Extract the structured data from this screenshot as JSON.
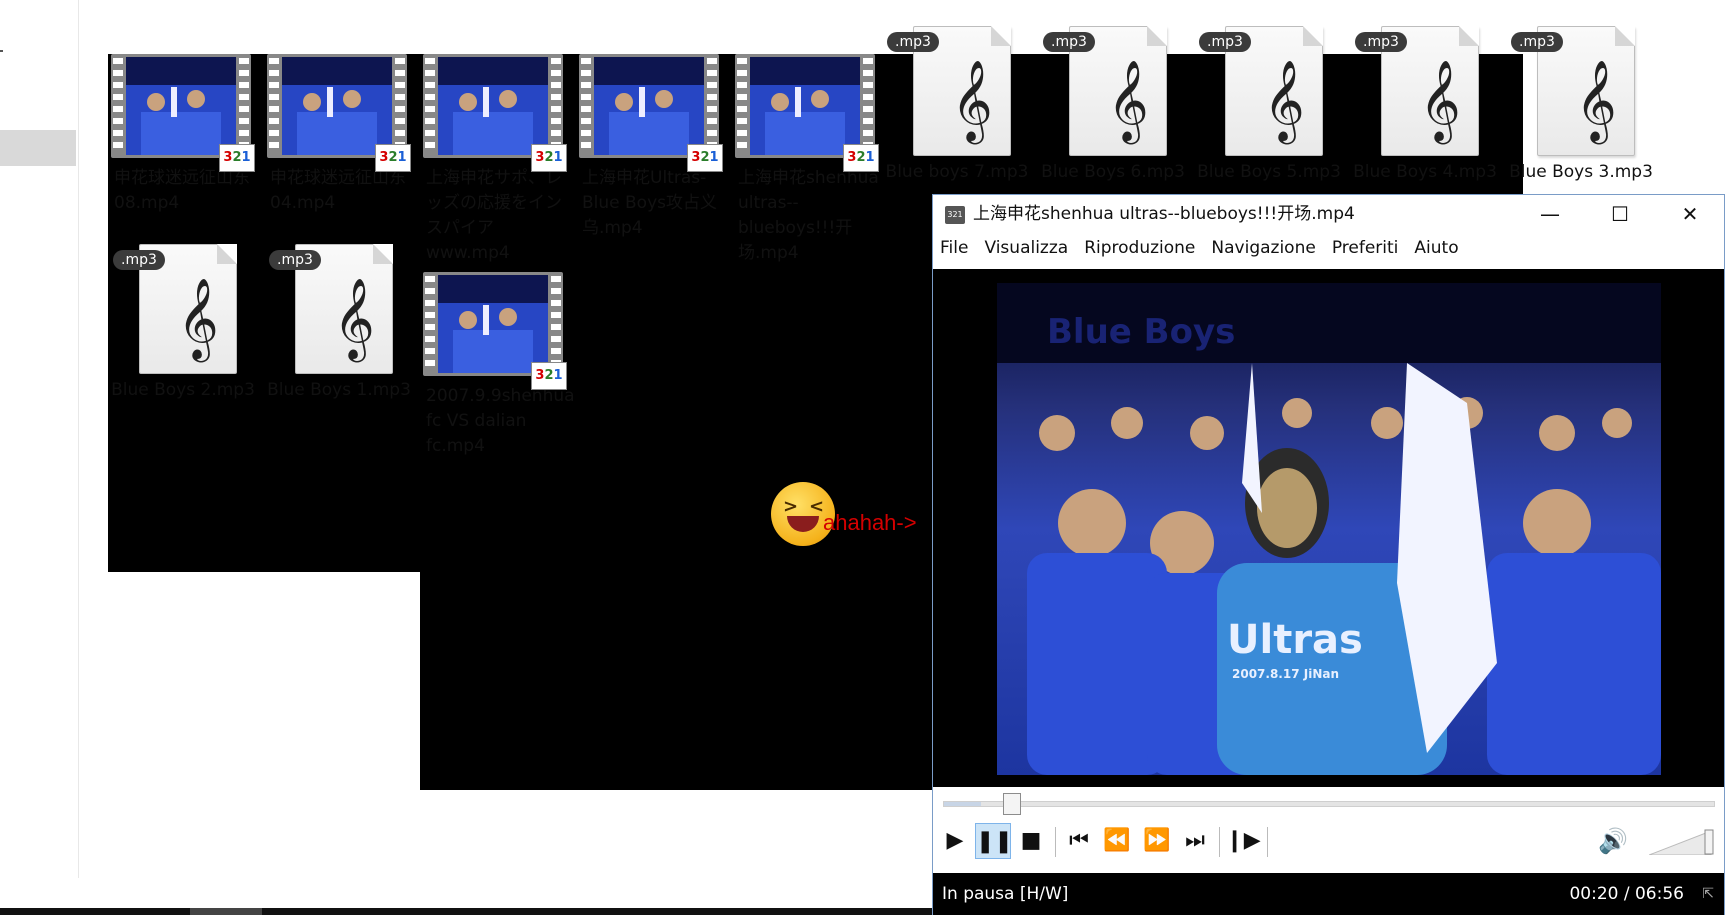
{
  "explorer": {
    "files": [
      {
        "name": "申花球迷远征山东08.mp4",
        "type": "video"
      },
      {
        "name": "申花球迷远征山东04.mp4",
        "type": "video"
      },
      {
        "name": "上海申花サポ、レッズの応援をインスパイアwww.mp4",
        "type": "video"
      },
      {
        "name": "上海申花Ultras-Blue Boys攻占义乌.mp4",
        "type": "video"
      },
      {
        "name": "上海申花shenhua ultras--blueboys!!!开场.mp4",
        "type": "video"
      },
      {
        "name": "Blue boys 7.mp3",
        "type": "audio"
      },
      {
        "name": "Blue Boys 6.mp3",
        "type": "audio"
      },
      {
        "name": "Blue Boys 5.mp3",
        "type": "audio"
      },
      {
        "name": "Blue Boys 4.mp3",
        "type": "audio"
      },
      {
        "name": "Blue Boys 3.mp3",
        "type": "audio"
      },
      {
        "name": "Blue Boys 2.mp3",
        "type": "audio"
      },
      {
        "name": "Blue Boys 1.mp3",
        "type": "audio"
      },
      {
        "name": "2007.9.9shenhuafc VS dalian fc.mp4",
        "type": "video"
      }
    ],
    "mp3_badge": ".mp3",
    "video_badge": [
      "3",
      "2",
      "1"
    ]
  },
  "annotation": {
    "text": "ahahah->",
    "emoji": "laughing-emoji-icon"
  },
  "player": {
    "title": "上海申花shenhua ultras--blueboys!!!开场.mp4",
    "window_buttons": {
      "minimize": "—",
      "maximize": "☐",
      "close": "✕"
    },
    "menu": [
      "File",
      "Visualizza",
      "Riproduzione",
      "Navigazione",
      "Preferiti",
      "Aiuto"
    ],
    "video_overlay_text": "Blue Boys",
    "shirt_text": "Ultras",
    "shirt_subtext": "2007.8.17 JiNan",
    "progress_fraction": 0.048,
    "volume_fraction": 1.0,
    "status": "In pausa [H/W]",
    "time": "00:20 / 06:56",
    "colors": {
      "accent": "#7eb4ea",
      "active_bg": "#cce4f7",
      "status_bg": "#000000"
    }
  }
}
